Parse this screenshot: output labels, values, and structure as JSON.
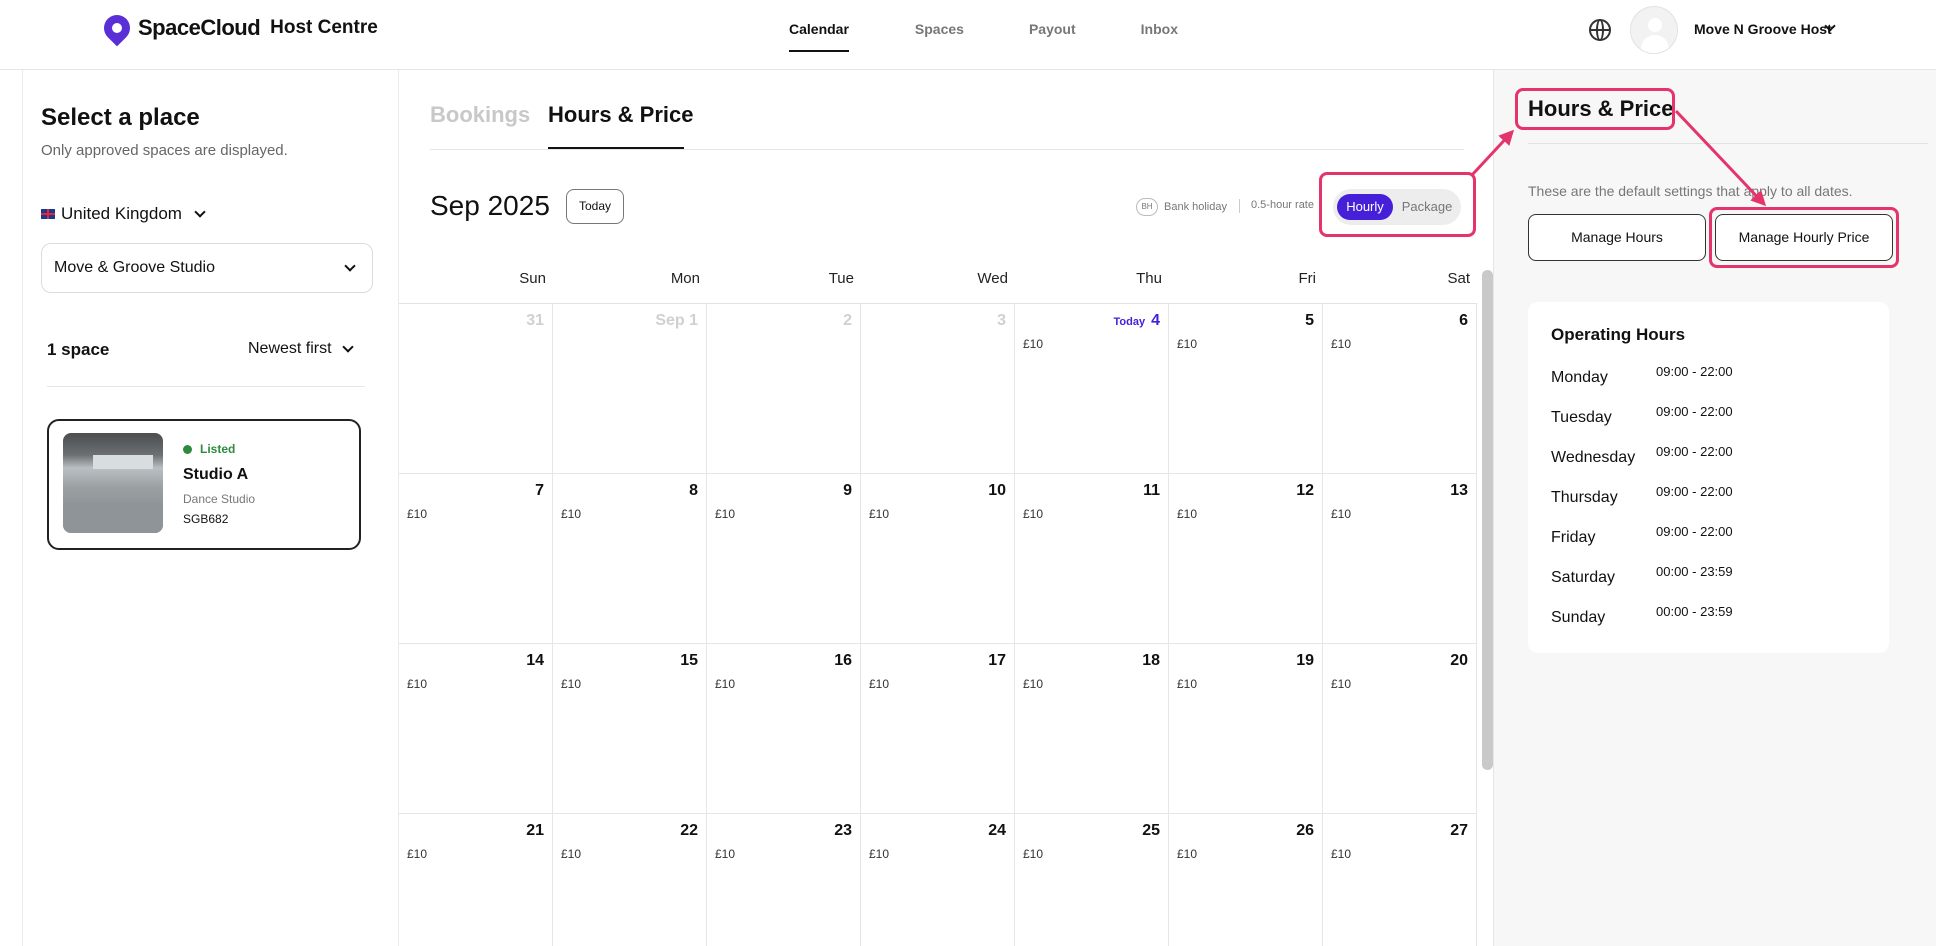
{
  "header": {
    "logo_text": "SpaceCloud",
    "logo_sub": "Host Centre",
    "nav": [
      {
        "label": "Calendar",
        "active": true
      },
      {
        "label": "Spaces",
        "active": false
      },
      {
        "label": "Payout",
        "active": false
      },
      {
        "label": "Inbox",
        "active": false
      }
    ],
    "user_name": "Move N Groove Host",
    "icons": [
      "globe-icon",
      "avatar",
      "chevron-down-icon"
    ]
  },
  "sidebar": {
    "title": "Select a place",
    "subtitle": "Only approved spaces are displayed.",
    "country": "United Kingdom",
    "studio": "Move & Groove Studio",
    "count": "1 space",
    "sort": "Newest first",
    "space": {
      "status": "Listed",
      "name": "Studio A",
      "type": "Dance Studio",
      "code": "SGB682"
    }
  },
  "main": {
    "tabs": [
      "Bookings",
      "Hours & Price"
    ],
    "active_tab": "Hours & Price",
    "month": "Sep 2025",
    "today_button": "Today",
    "legend": {
      "bh_icon": "BH",
      "bank_holiday": "Bank holiday",
      "rate": "0.5-hour rate"
    },
    "toggle": {
      "hourly": "Hourly",
      "package": "Package",
      "selected": "Hourly"
    },
    "today_label": "Today",
    "weekdays": [
      "Sun",
      "Mon",
      "Tue",
      "Wed",
      "Thu",
      "Fri",
      "Sat"
    ],
    "weeks": [
      [
        {
          "date": "31",
          "muted": true,
          "price": ""
        },
        {
          "date": "Sep 1",
          "muted": true,
          "price": ""
        },
        {
          "date": "2",
          "muted": true,
          "price": ""
        },
        {
          "date": "3",
          "muted": true,
          "price": ""
        },
        {
          "date": "4",
          "today": true,
          "price": "£10"
        },
        {
          "date": "5",
          "price": "£10"
        },
        {
          "date": "6",
          "price": "£10"
        }
      ],
      [
        {
          "date": "7",
          "price": "£10"
        },
        {
          "date": "8",
          "price": "£10"
        },
        {
          "date": "9",
          "price": "£10"
        },
        {
          "date": "10",
          "price": "£10"
        },
        {
          "date": "11",
          "price": "£10"
        },
        {
          "date": "12",
          "price": "£10"
        },
        {
          "date": "13",
          "price": "£10"
        }
      ],
      [
        {
          "date": "14",
          "price": "£10"
        },
        {
          "date": "15",
          "price": "£10"
        },
        {
          "date": "16",
          "price": "£10"
        },
        {
          "date": "17",
          "price": "£10"
        },
        {
          "date": "18",
          "price": "£10"
        },
        {
          "date": "19",
          "price": "£10"
        },
        {
          "date": "20",
          "price": "£10"
        }
      ],
      [
        {
          "date": "21",
          "price": "£10"
        },
        {
          "date": "22",
          "price": "£10"
        },
        {
          "date": "23",
          "price": "£10"
        },
        {
          "date": "24",
          "price": "£10"
        },
        {
          "date": "25",
          "price": "£10"
        },
        {
          "date": "26",
          "price": "£10"
        },
        {
          "date": "27",
          "price": "£10"
        }
      ]
    ]
  },
  "right_panel": {
    "title": "Hours & Price",
    "description": "These are the default settings that apply to all dates.",
    "manage_hours": "Manage Hours",
    "manage_price": "Manage Hourly Price",
    "operating_title": "Operating Hours",
    "hours": [
      {
        "day": "Monday",
        "time": "09:00 - 22:00"
      },
      {
        "day": "Tuesday",
        "time": "09:00 - 22:00"
      },
      {
        "day": "Wednesday",
        "time": "09:00 - 22:00"
      },
      {
        "day": "Thursday",
        "time": "09:00 - 22:00"
      },
      {
        "day": "Friday",
        "time": "09:00 - 22:00"
      },
      {
        "day": "Saturday",
        "time": "00:00 - 23:59"
      },
      {
        "day": "Sunday",
        "time": "00:00 - 23:59"
      }
    ]
  },
  "colors": {
    "accent": "#4520d8",
    "brand": "#5a2fd6",
    "highlight": "#e5336b",
    "listed": "#2e8b3e"
  }
}
